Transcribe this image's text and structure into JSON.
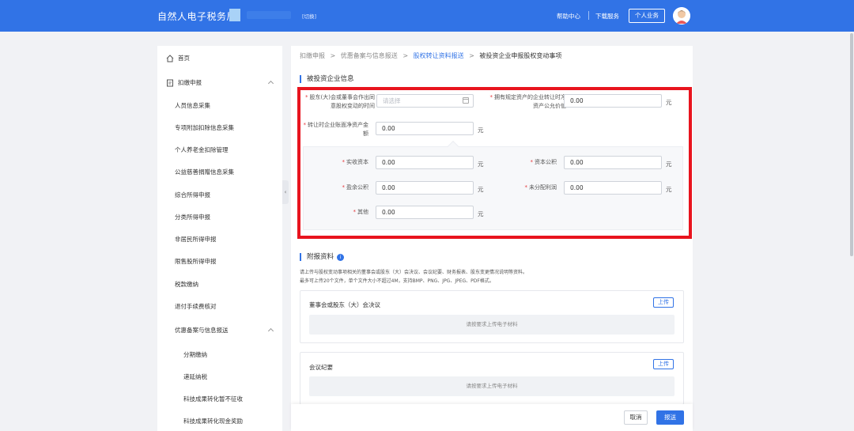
{
  "header": {
    "brand": "自然人电子税务局",
    "switch_label": "[切换]",
    "help": "帮助中心",
    "download": "下载服务",
    "personal": "个人业务"
  },
  "sidebar": {
    "home": "首页",
    "section_withholding": "扣缴申报",
    "items_withholding": [
      "人员信息采集",
      "专项附加扣除信息采集",
      "个人养老金扣除管理",
      "公益慈善捐赠信息采集",
      "综合所得申报",
      "分类所得申报",
      "非居民所得申报",
      "限售股所得申报",
      "税款缴纳",
      "退付手续费核对"
    ],
    "section_preferential": "优惠备案与信息报送",
    "items_preferential": [
      "分期缴纳",
      "递延纳税",
      "科技成果转化暂不征收",
      "科技成果转化现金奖励"
    ]
  },
  "breadcrumb": [
    "扣缴申报",
    "优惠备案与信息报送",
    "股权转让资料报送",
    "被投资企业申报股权变动事项"
  ],
  "separator": ">",
  "form": {
    "section_title": "被投资企业信息",
    "date_label": "股东(大)会或董事会作出同意股权变动的时间",
    "date_placeholder": "请选择",
    "fair_value_label": "拥有规定资产的企业转让时净资产公允价值",
    "fair_value": "0.00",
    "book_net_assets_label": "转让时企业账面净资产金额",
    "book_net_assets": "0.00",
    "paid_in_capital_label": "实收资本",
    "paid_in_capital": "0.00",
    "capital_reserve_label": "资本公积",
    "capital_reserve": "0.00",
    "surplus_reserve_label": "盈余公积",
    "surplus_reserve": "0.00",
    "undistributed_profit_label": "未分配利润",
    "undistributed_profit": "0.00",
    "other_label": "其他",
    "other": "0.00",
    "unit": "元",
    "required_mark": "*"
  },
  "attachments": {
    "section_title": "附报资料",
    "info_icon": "i",
    "desc_line1": "请上传与股权变动事项相关的董事会或股东（大）会决议、会议纪要、财务报表、股东变更情况说明等资料。",
    "desc_line2": "最多可上传20个文件，单个文件大小不超过4M，支持BMP、PNG、JPG、JPEG、PDF格式。",
    "cards": [
      {
        "title": "董事会或股东（大）会决议",
        "button": "上传",
        "drop_text": "请按要求上传电子材料"
      },
      {
        "title": "会议纪要",
        "button": "上传",
        "drop_text": "请按要求上传电子材料"
      }
    ]
  },
  "footer": {
    "cancel": "取消",
    "submit": "报送"
  },
  "colors": {
    "primary": "#3173e6",
    "highlight": "#e8141e",
    "required": "#e4393c"
  }
}
